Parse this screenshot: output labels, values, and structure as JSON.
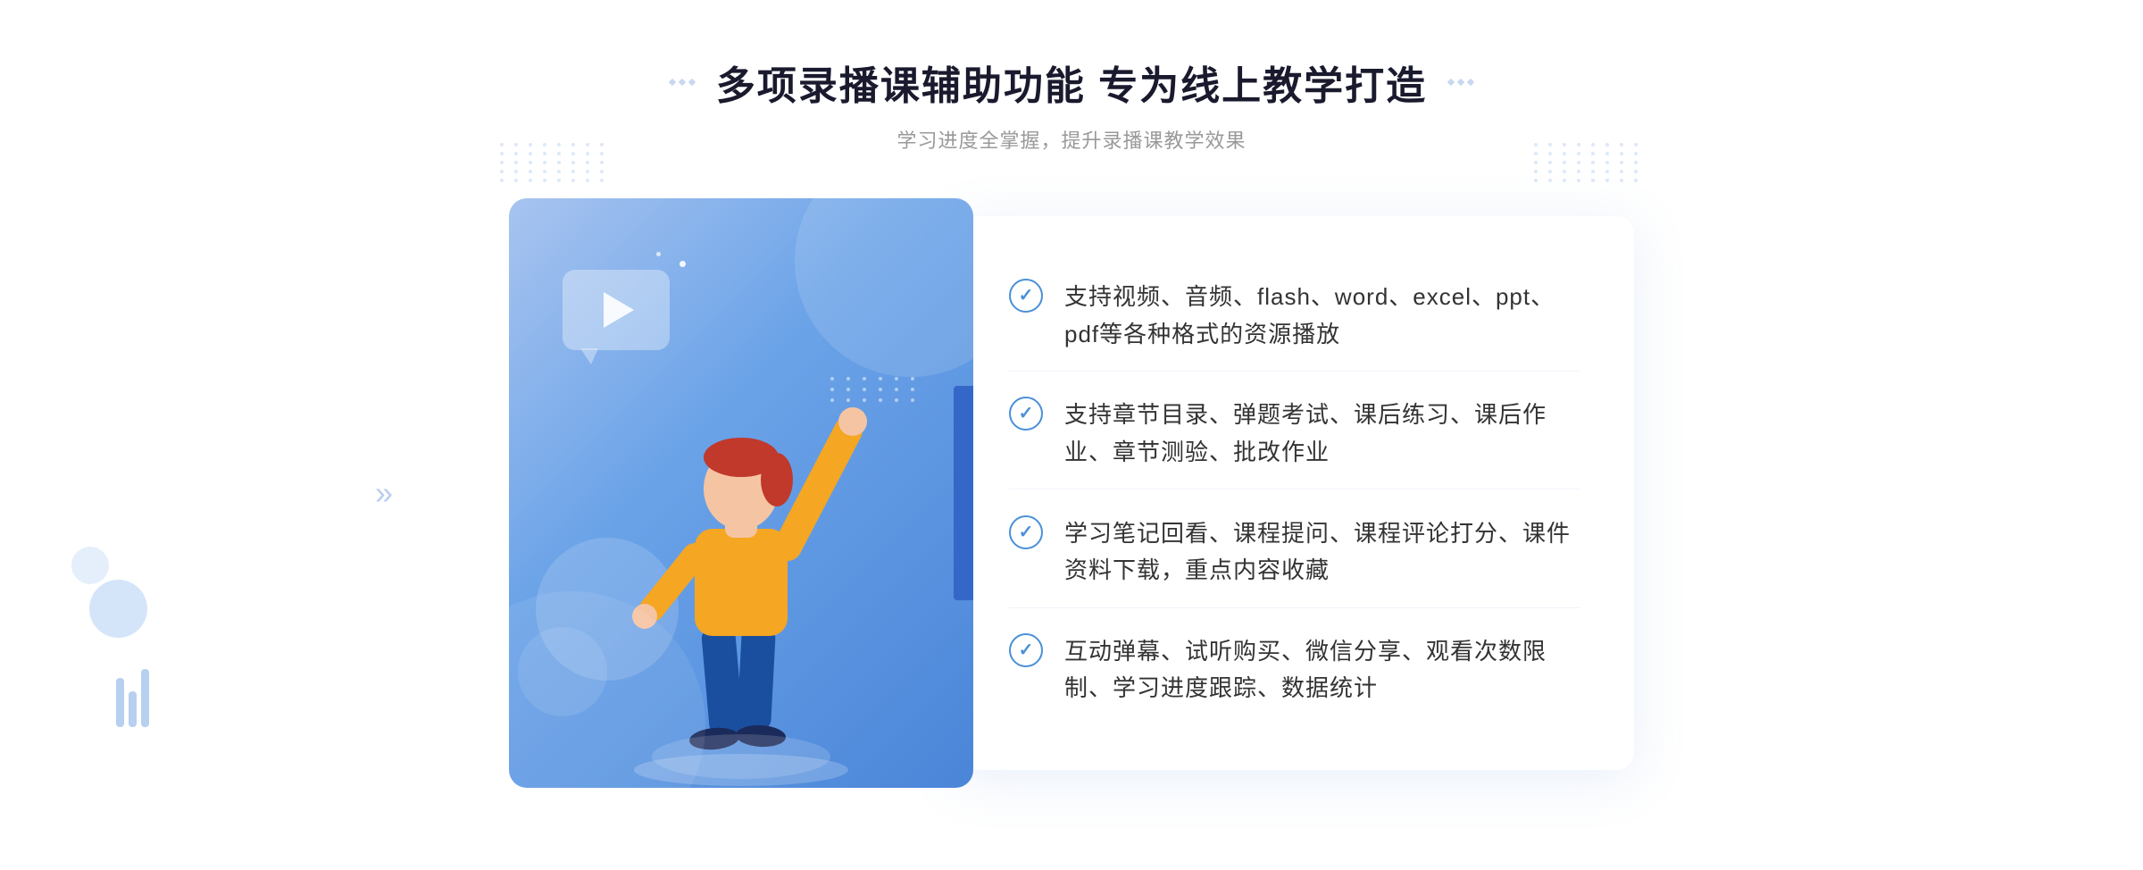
{
  "header": {
    "main_title": "多项录播课辅助功能 专为线上教学打造",
    "subtitle": "学习进度全掌握，提升录播课教学效果"
  },
  "features": [
    {
      "id": 1,
      "text": "支持视频、音频、flash、word、excel、ppt、pdf等各种格式的资源播放"
    },
    {
      "id": 2,
      "text": "支持章节目录、弹题考试、课后练习、课后作业、章节测验、批改作业"
    },
    {
      "id": 3,
      "text": "学习笔记回看、课程提问、课程评论打分、课件资料下载，重点内容收藏"
    },
    {
      "id": 4,
      "text": "互动弹幕、试听购买、微信分享、观看次数限制、学习进度跟踪、数据统计"
    }
  ],
  "icons": {
    "check": "✓",
    "left_arrow": "«"
  },
  "colors": {
    "brand_blue": "#4a85d8",
    "dark_blue": "#3567c8",
    "light_blue": "#a8c4f0",
    "text_dark": "#1a1a2e",
    "text_gray": "#999999",
    "text_body": "#333333"
  }
}
